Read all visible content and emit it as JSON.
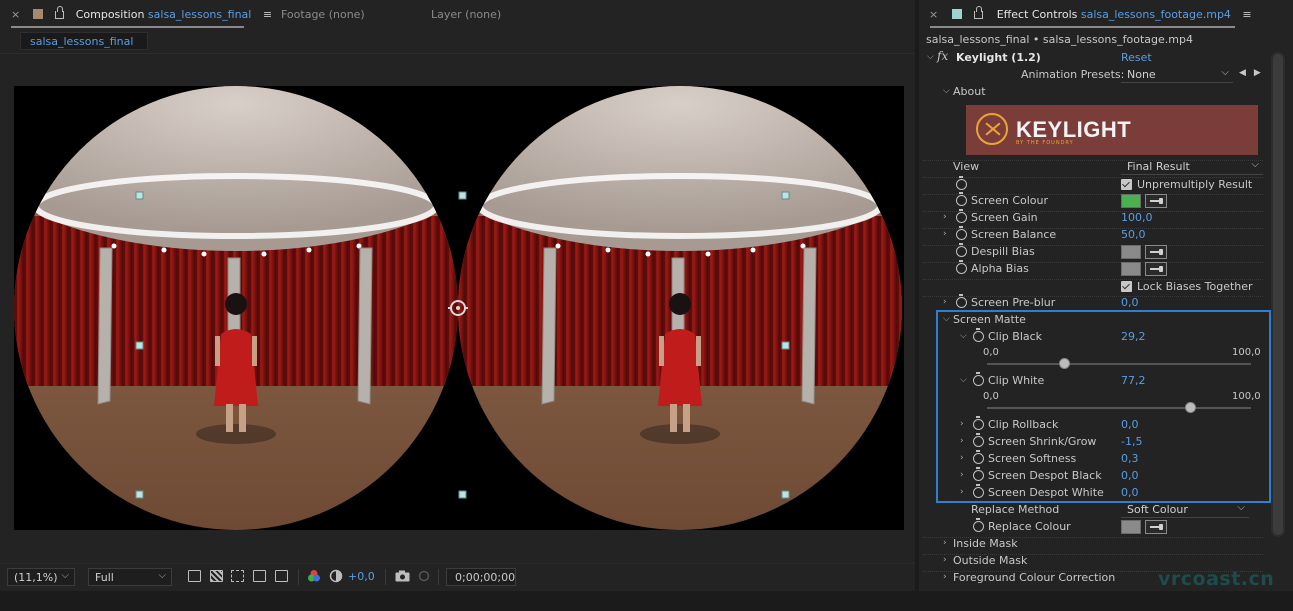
{
  "composition_panel": {
    "tabs": [
      {
        "close": "×",
        "label": "Composition",
        "name": "salsa_lessons_final",
        "menu": "≡"
      },
      {
        "label": "Footage (none)"
      },
      {
        "label": "Layer (none)"
      }
    ],
    "subtab": "salsa_lessons_final",
    "footer": {
      "zoom": "(11,1%)",
      "resolution": "Full",
      "exposure": "+0,0",
      "timecode": "0;00;00;00"
    }
  },
  "effect_controls": {
    "tab": {
      "close": "×",
      "label": "Effect Controls",
      "layer": "salsa_lessons_footage.mp4",
      "menu": "≡"
    },
    "breadcrumb": "salsa_lessons_final • salsa_lessons_footage.mp4",
    "effect": {
      "fx": "fx",
      "name": "Keylight (1.2)",
      "reset": "Reset"
    },
    "animation_presets": {
      "label": "Animation Presets:",
      "value": "None"
    },
    "about": "About",
    "logo": {
      "text": "KEYLIGHT",
      "sub": "BY THE FOUNDRY"
    },
    "view": {
      "label": "View",
      "value": "Final Result"
    },
    "unpremultiply": "Unpremultiply Result",
    "screen_colour": {
      "label": "Screen Colour",
      "color": "#4caf50"
    },
    "screen_gain": {
      "label": "Screen Gain",
      "value": "100,0"
    },
    "screen_balance": {
      "label": "Screen Balance",
      "value": "50,0"
    },
    "despill_bias": {
      "label": "Despill Bias",
      "color": "#8a8a8a"
    },
    "alpha_bias": {
      "label": "Alpha Bias",
      "color": "#8a8a8a"
    },
    "lock_biases": "Lock Biases Together",
    "screen_preblur": {
      "label": "Screen Pre-blur",
      "value": "0,0"
    },
    "screen_matte": {
      "label": "Screen Matte",
      "clip_black": {
        "label": "Clip Black",
        "value": "29,2",
        "min": "0,0",
        "max": "100,0",
        "fraction": 0.292
      },
      "clip_white": {
        "label": "Clip White",
        "value": "77,2",
        "min": "0,0",
        "max": "100,0",
        "fraction": 0.772
      },
      "clip_rollback": {
        "label": "Clip Rollback",
        "value": "0,0"
      },
      "shrink_grow": {
        "label": "Screen Shrink/Grow",
        "value": "-1,5"
      },
      "softness": {
        "label": "Screen Softness",
        "value": "0,3"
      },
      "despot_black": {
        "label": "Screen Despot Black",
        "value": "0,0"
      },
      "despot_white": {
        "label": "Screen Despot White",
        "value": "0,0"
      },
      "replace_method": {
        "label": "Replace Method",
        "value": "Soft Colour"
      },
      "replace_colour": {
        "label": "Replace Colour",
        "color": "#8a8a8a"
      }
    },
    "inside_mask": "Inside Mask",
    "outside_mask": "Outside Mask",
    "fg_colour_correction": "Foreground Colour Correction"
  },
  "watermark": "vrcoast.cn",
  "colors": {
    "accent": "#5a9de2",
    "selection": "#2e7ed3",
    "panel": "#232323"
  }
}
